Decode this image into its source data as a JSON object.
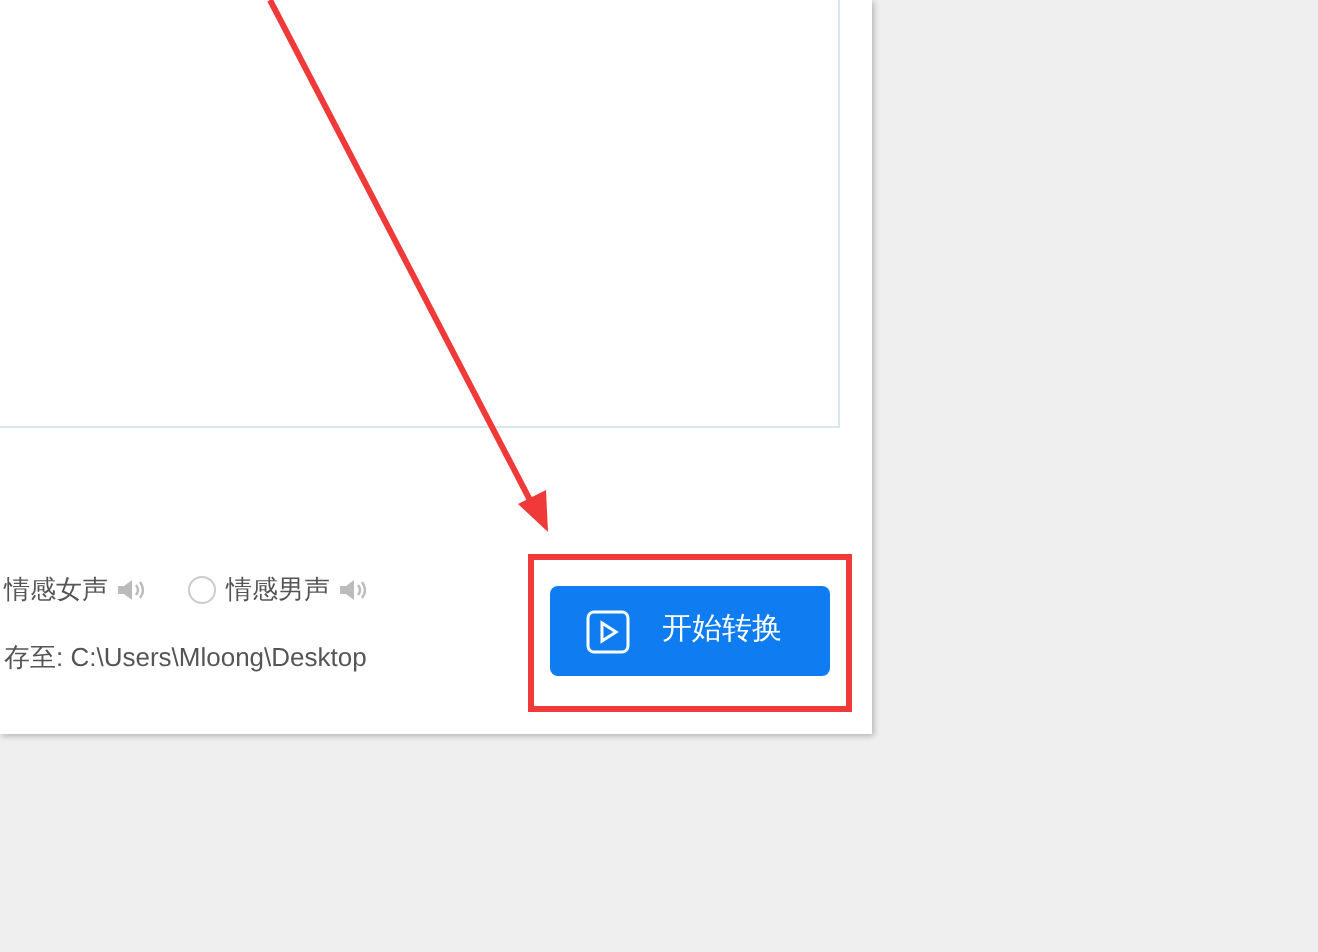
{
  "voices": [
    {
      "label": "情感女声"
    },
    {
      "label": "情感男声",
      "selected": false
    }
  ],
  "save_path": "存至: C:\\Users\\Mloong\\Desktop",
  "start_button": {
    "label": "开始转换"
  }
}
